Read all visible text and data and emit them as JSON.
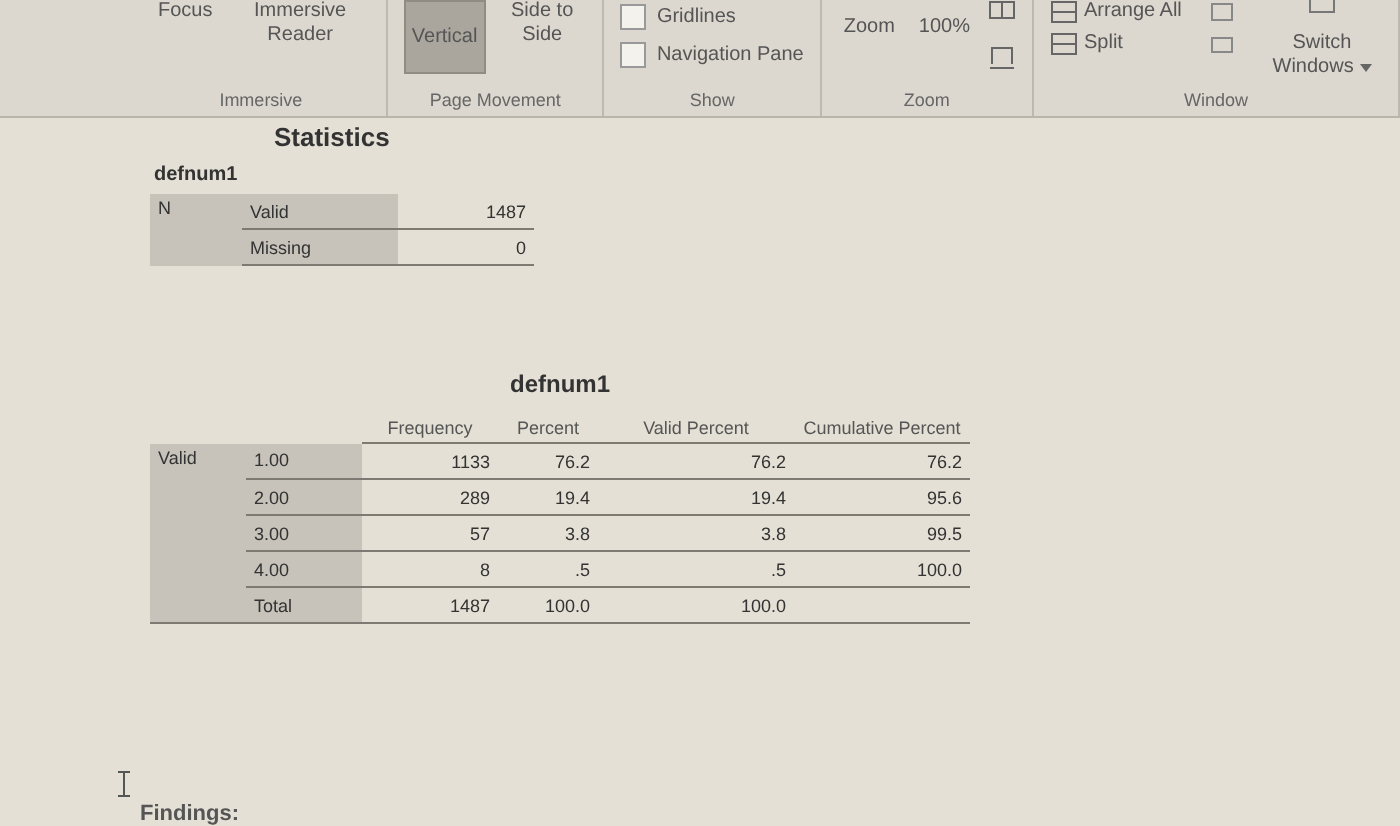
{
  "ribbon": {
    "groups": [
      {
        "kind": "buttons",
        "label": "Immersive",
        "items": [
          {
            "label": "Focus",
            "selected": false
          },
          {
            "label": "Immersive Reader",
            "selected": false
          }
        ]
      },
      {
        "kind": "buttons",
        "label": "Page Movement",
        "items": [
          {
            "label": "Vertical",
            "selected": true
          },
          {
            "label": "Side to Side",
            "selected": false
          }
        ]
      },
      {
        "kind": "checks",
        "label": "Show",
        "items": [
          {
            "label": "Gridlines",
            "checked": false
          },
          {
            "label": "Navigation Pane",
            "checked": false
          }
        ]
      },
      {
        "kind": "zoom",
        "label": "Zoom",
        "items": [
          {
            "label": "Zoom"
          },
          {
            "label": "100%"
          }
        ]
      },
      {
        "kind": "window",
        "label": "Window",
        "items": [
          {
            "label": "Arrange All"
          },
          {
            "label": "Split"
          },
          {
            "label": "Switch Windows"
          }
        ]
      }
    ]
  },
  "statistics": {
    "title": "Statistics",
    "variable": "defnum1",
    "group_label": "N",
    "rows": [
      {
        "label": "Valid",
        "value": "1487"
      },
      {
        "label": "Missing",
        "value": "0"
      }
    ]
  },
  "frequency": {
    "title": "defnum1",
    "columns": [
      "Frequency",
      "Percent",
      "Valid Percent",
      "Cumulative Percent"
    ],
    "group_label": "Valid",
    "rows": [
      {
        "label": "1.00",
        "cells": [
          "1133",
          "76.2",
          "76.2",
          "76.2"
        ]
      },
      {
        "label": "2.00",
        "cells": [
          "289",
          "19.4",
          "19.4",
          "95.6"
        ]
      },
      {
        "label": "3.00",
        "cells": [
          "57",
          "3.8",
          "3.8",
          "99.5"
        ]
      },
      {
        "label": "4.00",
        "cells": [
          "8",
          ".5",
          ".5",
          "100.0"
        ]
      },
      {
        "label": "Total",
        "cells": [
          "1487",
          "100.0",
          "100.0"
        ]
      }
    ]
  },
  "findings": "Findings:"
}
